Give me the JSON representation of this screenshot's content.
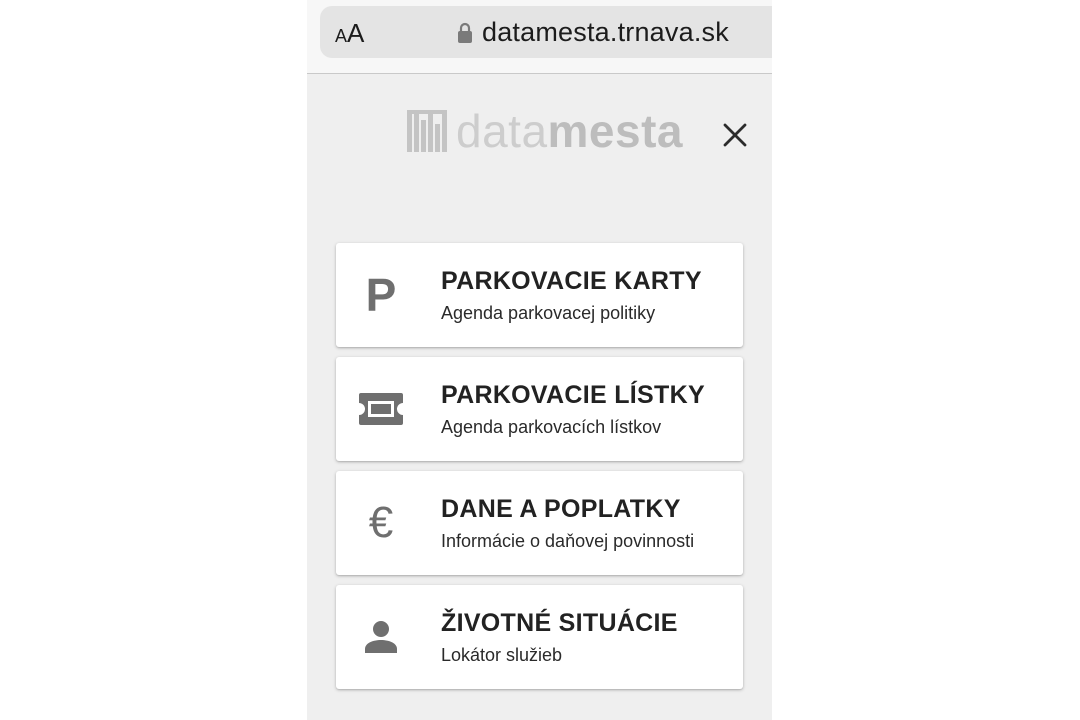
{
  "browser": {
    "text_size_small": "A",
    "text_size_large": "A",
    "url": "datamesta.trnava.sk",
    "lock_icon": "lock-icon"
  },
  "header": {
    "logo_light": "data",
    "logo_bold": "mesta",
    "close_icon": "close-icon"
  },
  "menu": {
    "items": [
      {
        "icon": "parking-p-icon",
        "glyph": "P",
        "title": "PARKOVACIE KARTY",
        "subtitle": "Agenda parkovacej politiky"
      },
      {
        "icon": "ticket-icon",
        "title": "PARKOVACIE LÍSTKY",
        "subtitle": "Agenda parkovacích lístkov"
      },
      {
        "icon": "euro-icon",
        "glyph": "€",
        "title": "DANE A POPLATKY",
        "subtitle": "Informácie o daňovej povinnosti"
      },
      {
        "icon": "person-icon",
        "title": "ŽIVOTNÉ SITUÁCIE",
        "subtitle": "Lokátor služieb"
      }
    ]
  },
  "colors": {
    "page_bg": "#efefef",
    "card_bg": "#ffffff",
    "icon_gray": "#6f6f6f",
    "title_text": "#222222"
  }
}
